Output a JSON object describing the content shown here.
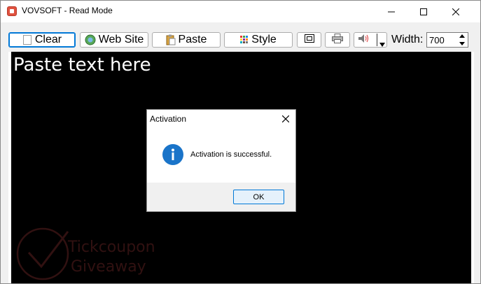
{
  "window": {
    "title": "VOVSOFT - Read Mode"
  },
  "toolbar": {
    "clear_label": "Clear",
    "website_label": "Web Site",
    "paste_label": "Paste",
    "style_label": "Style",
    "width_label": "Width:",
    "width_value": "700"
  },
  "editor": {
    "placeholder_text": "Paste text here"
  },
  "watermark": {
    "line1": "Tickcoupon",
    "line2": "Giveaway"
  },
  "dialog": {
    "title": "Activation",
    "message": "Activation is successful.",
    "ok_label": "OK"
  },
  "colors": {
    "accent": "#0078d7",
    "info_icon": "#1a74c9",
    "editor_bg": "#000000",
    "app_icon": "#e0523f"
  }
}
